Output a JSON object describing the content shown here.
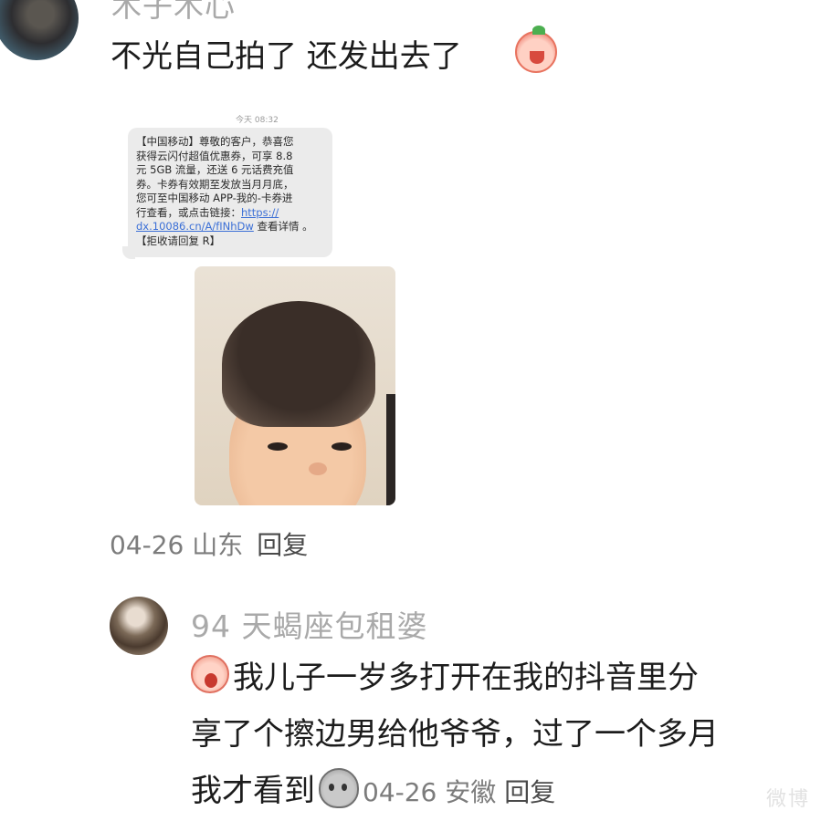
{
  "comment1": {
    "username": "木子木心",
    "text": "不光自己拍了 还发出去了",
    "emoji": "crying-face-emoji",
    "meta": {
      "date": "04-26",
      "location": "山东",
      "reply_label": "回复"
    }
  },
  "sms": {
    "timestamp": "今天 08:32",
    "lines": [
      "【中国移动】尊敬的客户，恭喜您",
      "获得云闪付超值优惠券，可享 8.8",
      "元 5GB 流量，还送 6 元话费充值",
      "券。卡券有效期至发放当月月底，",
      "您可至中国移动 APP-我的-卡券进",
      "行查看，或点击链接："
    ],
    "link_part1": "https://",
    "link_part2": "dx.10086.cn/A/fINhDw",
    "after_link": " 查看详情 。",
    "unsubscribe": "【拒收请回复 R】"
  },
  "comment2": {
    "username": "94 天蝎座包租婆",
    "line1": "我儿子一岁多打开在我的抖音里分",
    "line2": "享了个擦边男给他爷爷，过了一个多月",
    "line3": "我才看到",
    "meta": {
      "date": "04-26",
      "location": "安徽",
      "reply_label": "回复"
    }
  },
  "watermark": "微博"
}
